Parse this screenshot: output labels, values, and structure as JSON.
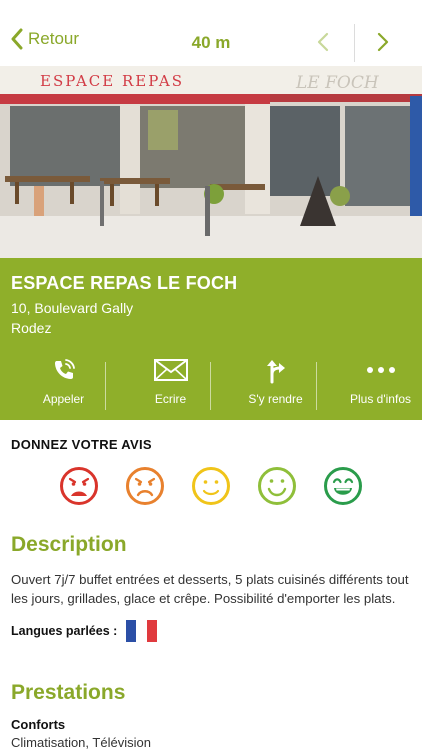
{
  "nav": {
    "back_label": "Retour",
    "distance": "40 m",
    "prev_icon": "chevron-left-icon",
    "next_icon": "chevron-right-icon"
  },
  "photo": {
    "sign_left": "ESPACE REPAS",
    "sign_right": "LE FOCH"
  },
  "place": {
    "name": "ESPACE REPAS LE FOCH",
    "street": "10, Boulevard Gally",
    "city": "Rodez"
  },
  "actions": [
    {
      "label": "Appeler",
      "icon": "phone-icon"
    },
    {
      "label": "Ecrire",
      "icon": "envelope-icon"
    },
    {
      "label": "S'y rendre",
      "icon": "directions-icon"
    },
    {
      "label": "Plus d'infos",
      "icon": "more-icon"
    }
  ],
  "review": {
    "title": "DONNEZ VOTRE AVIS",
    "ratings": [
      {
        "icon": "very-sad-face-icon",
        "color": "#d9342b"
      },
      {
        "icon": "sad-face-icon",
        "color": "#e8812e"
      },
      {
        "icon": "neutral-face-icon",
        "color": "#f0c419"
      },
      {
        "icon": "happy-face-icon",
        "color": "#8fbf3a"
      },
      {
        "icon": "very-happy-face-icon",
        "color": "#2a9c4b"
      }
    ]
  },
  "description": {
    "title": "Description",
    "text": "Ouvert 7j/7 buffet entrées et desserts, 5 plats cuisinés différents tout les jours, grillades, glace et crêpe. Possibilité d'emporter les plats.",
    "languages_label": "Langues parlées :",
    "language_flag": "french-flag-icon"
  },
  "services": {
    "title": "Prestations",
    "comfort_label": "Conforts",
    "comfort_value": "Climatisation, Télévision"
  },
  "colors": {
    "accent": "#8faf2a",
    "text_accent": "#8aa82a"
  }
}
